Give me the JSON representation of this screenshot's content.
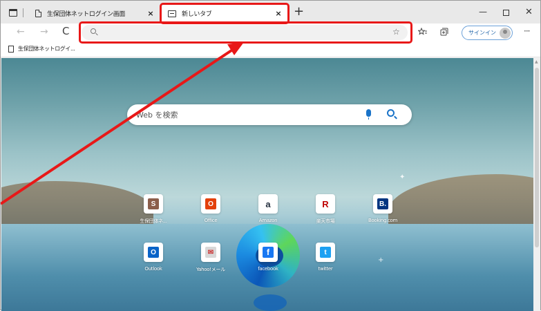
{
  "tabs": [
    {
      "title": "生保団体ネットログイン画面",
      "close": "×"
    },
    {
      "title": "新しいタブ",
      "close": "×"
    }
  ],
  "new_tab_symbol": "+",
  "window_controls": {
    "minimize": "—",
    "close": "✕"
  },
  "toolbar": {
    "back": "←",
    "forward": "→",
    "reload": "C",
    "address_value": "",
    "favorite_symbol": "☆",
    "signin_label": "サインイン",
    "more": "···"
  },
  "bookmarks": [
    {
      "label": "生保団体ネットログイ..."
    }
  ],
  "search": {
    "placeholder": "Web を検索"
  },
  "tiles": [
    {
      "label": "生保団体ネ...",
      "glyph": "S",
      "color": "#8b5e4b"
    },
    {
      "label": "Office",
      "glyph": "O",
      "color": "#e3400b"
    },
    {
      "label": "Amazon",
      "glyph": "a",
      "color": "#232f3e"
    },
    {
      "label": "楽天市場",
      "glyph": "R",
      "color": "#bf0000"
    },
    {
      "label": "Booking.com",
      "glyph": "B.",
      "color": "#003580"
    },
    {
      "label": "Outlook",
      "glyph": "O",
      "color": "#0a64c8"
    },
    {
      "label": "Yahoo!メール",
      "glyph": "✉",
      "color": "#c7c7c7"
    },
    {
      "label": "facebook",
      "glyph": "f",
      "color": "#1877f2"
    },
    {
      "label": "twitter",
      "glyph": "t",
      "color": "#1da1f2"
    }
  ],
  "highlight_color": "#e81818"
}
